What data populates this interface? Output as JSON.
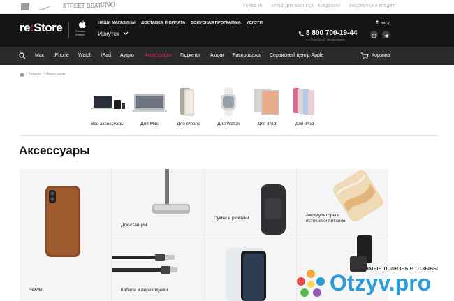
{
  "topbar": {
    "brands": [
      "STREET BEAT",
      "UNO"
    ],
    "links": [
      "TRADE-IN",
      "APPLE ДЛЯ БИЗНЕСА",
      "АКАДЕМИЯ",
      "РАССРОЧКА И КРЕДИТ"
    ]
  },
  "header": {
    "logo_main": "re",
    "logo_colon": ":",
    "logo_store": "Store",
    "reseller": "Premium Reseller",
    "links": [
      "НАШИ МАГАЗИНЫ",
      "ДОСТАВКА И ОПЛАТА",
      "БОНУСНАЯ ПРОГРАММА",
      "УСЛУГИ"
    ],
    "city": "Иркутск",
    "phone": "8 800 700-19-44",
    "phone_hours": "с 8:00 до 22:00, без выходных",
    "login": "ВХОД"
  },
  "nav": {
    "items": [
      "Mac",
      "iPhone",
      "Watch",
      "iPad",
      "Аудио",
      "Аксессуары",
      "Гаджеты",
      "Акции",
      "Распродажа",
      "Сервисный центр Apple"
    ],
    "active_index": 5,
    "cart": "Корзина"
  },
  "breadcrumb": [
    "Каталог",
    "Аксессуары"
  ],
  "categories": [
    "Все аксессуары",
    "Для Mac",
    "Для iPhone",
    "Для Watch",
    "Для iPad",
    "Для iPod"
  ],
  "page_title": "Аксессуары",
  "tiles": [
    "Чехлы",
    "Док-станции",
    "Сумки и рюкзаки",
    "Аккумуляторы и источники питания",
    "Кабели и переходники"
  ],
  "watermark": {
    "tagline": "самые полезные отзывы",
    "site": "Otzyv",
    "dot": ".",
    "tld": "pro"
  },
  "colors": {
    "accent": "#e2224c",
    "header_bg": "#151515",
    "nav_bg": "#2a2a2a",
    "watermark": "#2b9cd8"
  }
}
